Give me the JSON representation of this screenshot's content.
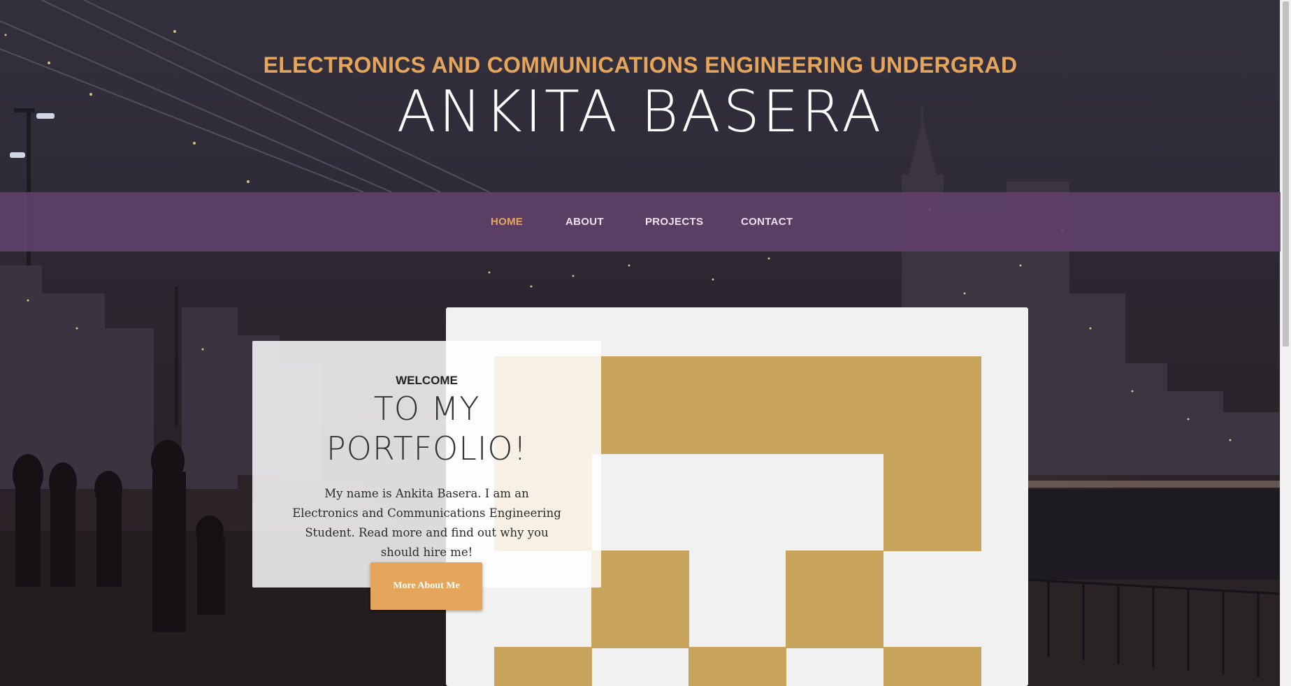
{
  "header": {
    "tagline": "ELECTRONICS AND COMMUNICATIONS ENGINEERING UNDERGRAD",
    "name": "ANKITA BASERA"
  },
  "nav": {
    "items": [
      {
        "label": "HOME",
        "active": true
      },
      {
        "label": "ABOUT",
        "active": false
      },
      {
        "label": "PROJECTS",
        "active": false
      },
      {
        "label": "CONTACT",
        "active": false
      }
    ]
  },
  "welcome": {
    "label": "WELCOME",
    "title_line1": "TO MY",
    "title_line2": "PORTFOLIO!",
    "body": "My name is Ankita Basera. I am an Electronics and Communications Engineering Student. Read more and find out why you should hire me!",
    "button_label": "More About Me"
  },
  "colors": {
    "accent": "#e5a55b",
    "nav_bg": "#62416b",
    "pattern_gold": "#c9a45d",
    "card_bg": "#f1f1f1"
  },
  "icons": {
    "hero_image": "identicon-pattern"
  }
}
